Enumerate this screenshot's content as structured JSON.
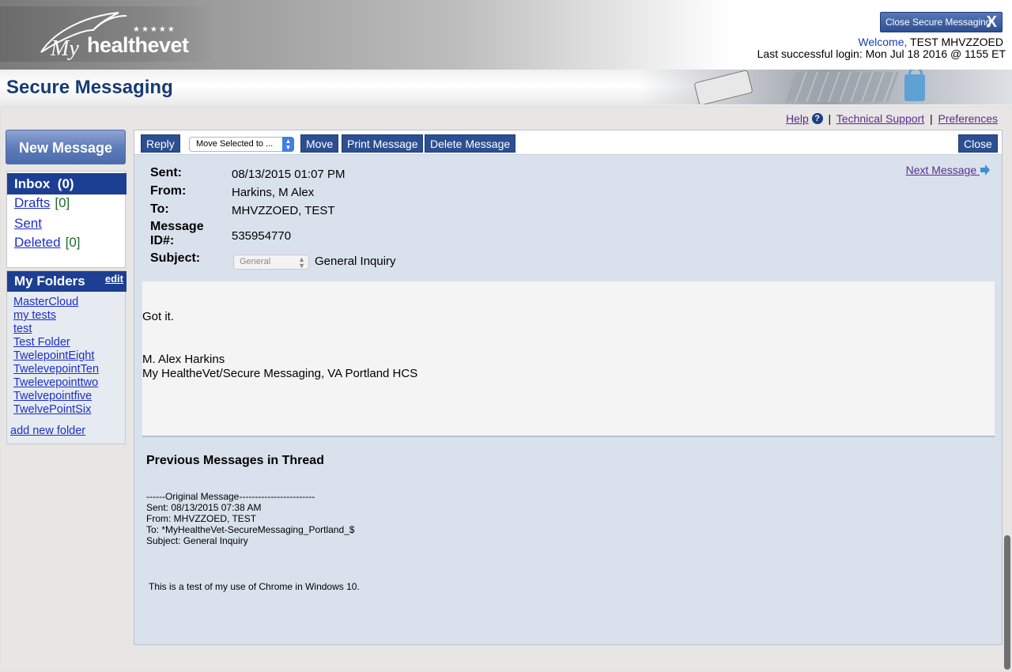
{
  "header": {
    "logo_my": "My",
    "logo_text": "healthevet",
    "logo_stars": "★★★★★",
    "close_button": "Close Secure Messaging",
    "close_glyph": "X",
    "welcome_label": "Welcome,",
    "welcome_user": "TEST MHVZZOED",
    "last_login": "Last successful login: Mon Jul 18 2016 @ 1155 ET"
  },
  "title": "Secure Messaging",
  "help_links": {
    "help": "Help",
    "help_icon": "?",
    "technical_support": "Technical Support",
    "preferences": "Preferences",
    "separator": "|"
  },
  "sidebar": {
    "new_message": "New Message",
    "inbox": "Inbox",
    "inbox_count": "(0)",
    "folders": [
      {
        "label": "Drafts",
        "count": "[0]"
      },
      {
        "label": "Sent",
        "count": ""
      },
      {
        "label": "Deleted",
        "count": "[0]"
      }
    ],
    "my_folders_title": "My Folders",
    "my_folders_edit": "edit",
    "my_folders": [
      "MasterCloud",
      "my tests",
      "test",
      "Test Folder",
      "TwelepointEight",
      "TwelevepointTen",
      "Twelevepointtwo",
      "Twelvepointfive",
      "TwelvePointSix"
    ],
    "add_folder": "add new folder"
  },
  "toolbar": {
    "reply": "Reply",
    "move_select": "Move Selected to ...",
    "move": "Move",
    "print": "Print Message",
    "delete": "Delete Message",
    "close": "Close"
  },
  "message": {
    "sent_label": "Sent:",
    "sent": "08/13/2015 01:07 PM",
    "from_label": "From:",
    "from": "Harkins, M Alex",
    "to_label": "To:",
    "to": "MHVZZOED, TEST",
    "id_label_1": "Message",
    "id_label_2": "ID#:",
    "id": "535954770",
    "subject_label": "Subject:",
    "subject_category": "General",
    "subject": "General Inquiry",
    "next": "Next Message",
    "body": [
      "Got it.",
      "M. Alex Harkins",
      "My HealtheVet/Secure Messaging, VA Portland HCS"
    ]
  },
  "thread": {
    "title": "Previous Messages in Thread",
    "lines": [
      "------Original Message------------------------",
      "Sent: 08/13/2015 07:38 AM",
      "From: MHVZZOED, TEST",
      "To: *MyHealtheVet-SecureMessaging_Portland_$",
      "Subject: General Inquiry"
    ],
    "body": "This is a test of my use of Chrome in Windows 10."
  }
}
